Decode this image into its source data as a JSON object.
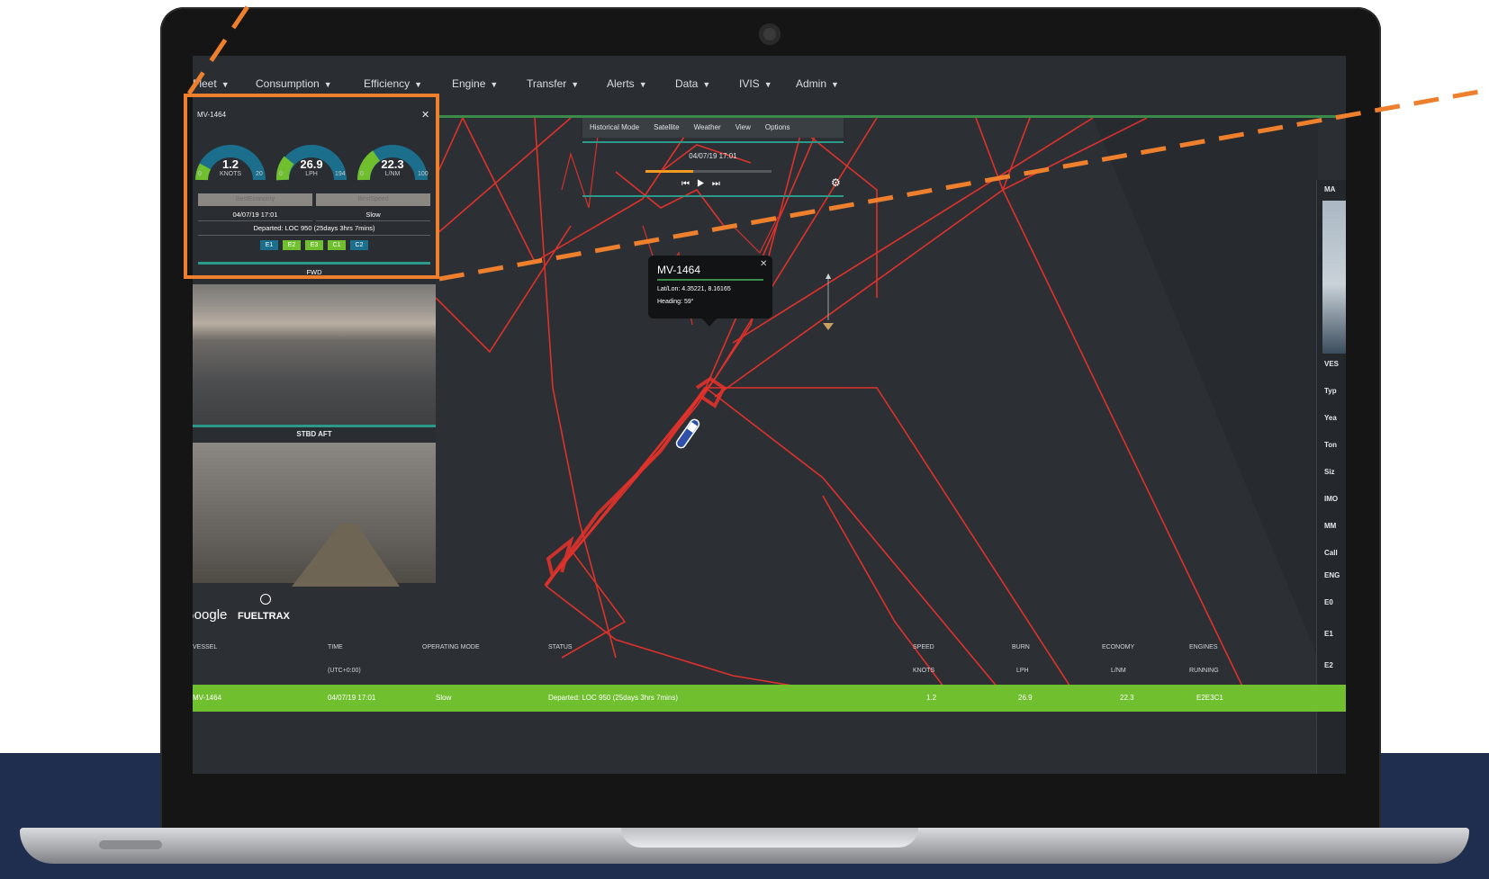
{
  "nav": {
    "items": [
      "Fleet",
      "Consumption",
      "Efficiency",
      "Engine",
      "Transfer",
      "Alerts",
      "Data",
      "IVIS",
      "Admin"
    ]
  },
  "panel": {
    "title": "MV-1464",
    "gauges": [
      {
        "value": "1.2",
        "unit": "KNOTS",
        "min": "0",
        "max": "20"
      },
      {
        "value": "26.9",
        "unit": "LPH",
        "min": "0",
        "max": "194"
      },
      {
        "value": "22.3",
        "unit": "L/NM",
        "min": "0",
        "max": "100"
      }
    ],
    "tabs": [
      "BestEconomy",
      "BestSpeed"
    ],
    "timestamp": "04/07/19 17:01",
    "mode": "Slow",
    "departed": "Departed: LOC 950 (25days 3hrs 7mins)",
    "engines": [
      "E1",
      "E2",
      "E3",
      "C1",
      "C2"
    ],
    "footer": "FWD"
  },
  "cameras": {
    "stbd_label": "STBD AFT"
  },
  "branding": {
    "google": "Google",
    "fueltrax": "FUELTRAX"
  },
  "playback": {
    "tabs": [
      "Historical Mode",
      "Satellite",
      "Weather",
      "View",
      "Options"
    ],
    "date": "04/07/19 17:01",
    "progress": 0.38
  },
  "popup": {
    "title": "MV-1464",
    "latlon": "Lat/Lon: 4.35221, 8.16165",
    "heading": "Heading: 59°"
  },
  "right_strip": {
    "labels": [
      "MA",
      "VES",
      "Typ",
      "Yea",
      "Ton",
      "Siz",
      "IMO",
      "MM",
      "Call",
      "ENG",
      "E0",
      "E1",
      "E2"
    ]
  },
  "table": {
    "headers_row1": [
      "VESSEL",
      "TIME",
      "OPERATING MODE",
      "STATUS",
      "SPEED",
      "BURN",
      "ECONOMY",
      "ENGINES"
    ],
    "headers_row2": [
      "(UTC+0:00)",
      "KNOTS",
      "LPH",
      "L/NM",
      "RUNNING"
    ],
    "row": {
      "vessel": "MV-1464",
      "time": "04/07/19 17:01",
      "mode": "Slow",
      "status": "Departed: LOC 950 (25days 3hrs 7mins)",
      "speed": "1.2",
      "burn": "26.9",
      "economy": "22.3",
      "engines": "E2E3C1"
    }
  },
  "colors": {
    "accent_orange": "#ee7f2d",
    "track_red": "#e8322a",
    "row_green": "#6fbf2e",
    "teal": "#2b9a8a",
    "navy": "#1f2d4f"
  }
}
